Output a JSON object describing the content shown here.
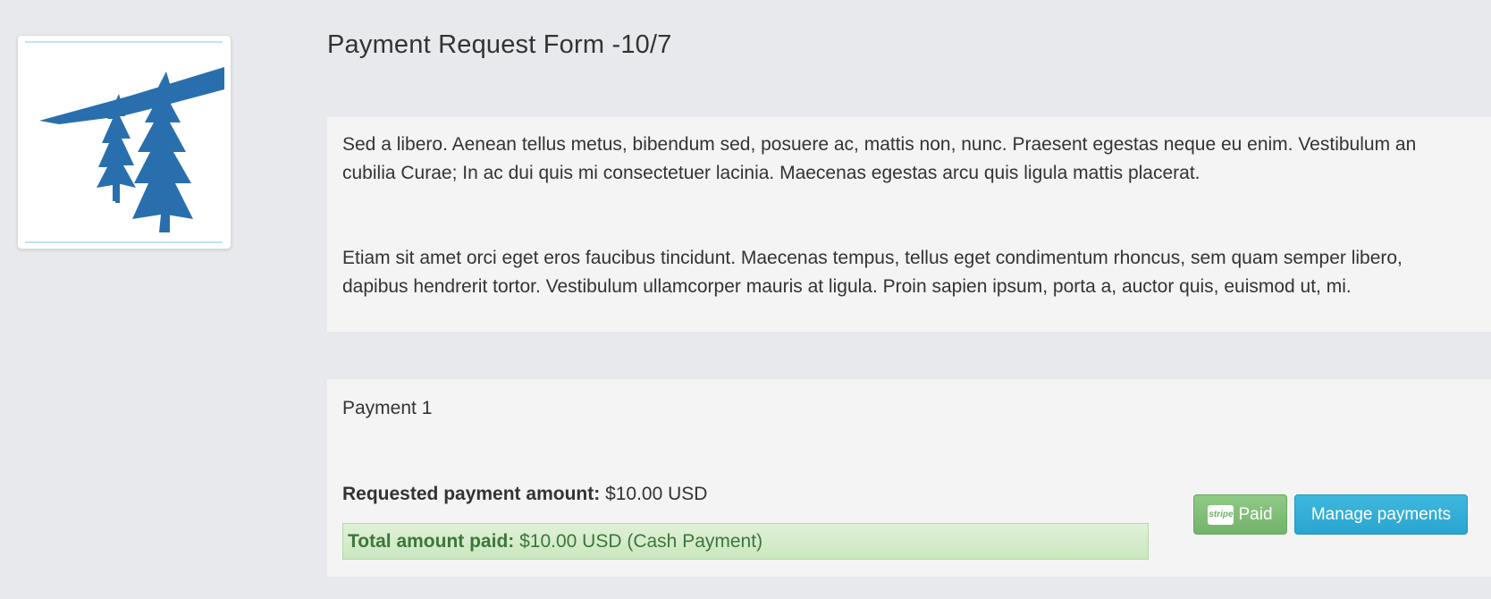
{
  "logo": {
    "icon": "pine-trees-logo-icon",
    "color": "#2a6fad"
  },
  "page": {
    "title": "Payment Request Form -10/7"
  },
  "description": {
    "paragraphs": [
      {
        "line1": "Sed a libero. Aenean tellus metus, bibendum sed, posuere ac, mattis non, nunc. Praesent egestas neque eu enim. Vestibulum an",
        "line2": "cubilia Curae; In ac dui quis mi consectetuer lacinia. Maecenas egestas arcu quis ligula mattis placerat."
      },
      {
        "line1": "Etiam sit amet orci eget eros faucibus tincidunt. Maecenas tempus, tellus eget condimentum rhoncus, sem quam semper libero,",
        "line2": "dapibus hendrerit tortor. Vestibulum ullamcorper mauris at ligula. Proin sapien ipsum, porta a, auctor quis, euismod ut, mi."
      }
    ]
  },
  "payment": {
    "title": "Payment 1",
    "requested_label": "Requested payment amount:",
    "requested_value": "$10.00 USD",
    "paid_label": "Total amount paid:",
    "paid_value": "$10.00 USD (Cash Payment)",
    "paid_button_badge": "stripe",
    "paid_button_label": "Paid",
    "manage_button_label": "Manage payments"
  },
  "colors": {
    "background": "#e8e9ec",
    "panel": "#f4f4f5",
    "success_text": "#3c763d",
    "paid_button": "#7fbd76",
    "info_button": "#31b0d5"
  }
}
